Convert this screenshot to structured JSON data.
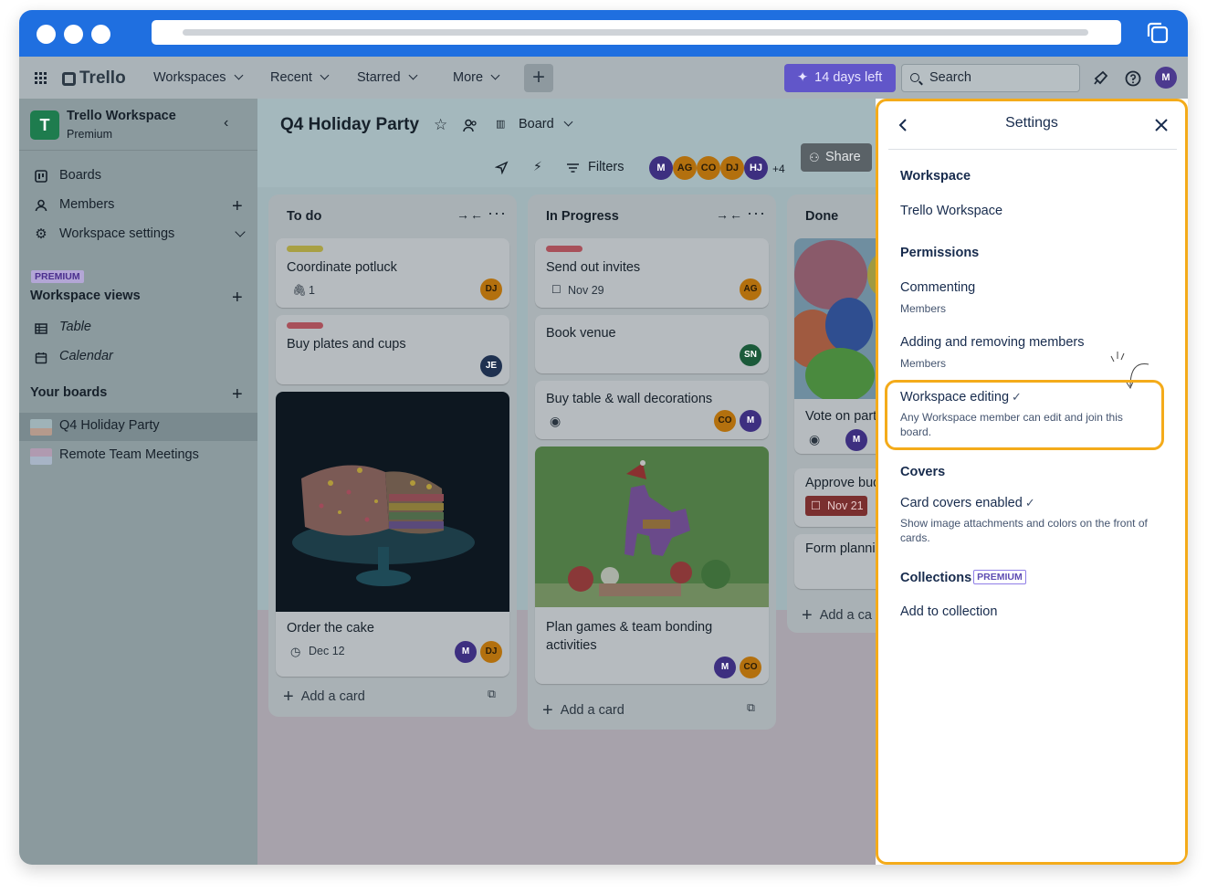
{
  "topnav": {
    "app_name": "Trello",
    "workspaces": "Workspaces",
    "recent": "Recent",
    "starred": "Starred",
    "more": "More",
    "create": "+",
    "trial": "14 days left",
    "search_placeholder": "Search",
    "user_initial": "M"
  },
  "sidebar": {
    "workspace_initial": "T",
    "workspace_name": "Trello Workspace",
    "workspace_plan": "Premium",
    "items": [
      {
        "label": "Boards"
      },
      {
        "label": "Members"
      },
      {
        "label": "Workspace settings"
      }
    ],
    "premium_tag": "PREMIUM",
    "views_heading": "Workspace views",
    "views": [
      {
        "label": "Table"
      },
      {
        "label": "Calendar"
      }
    ],
    "boards_heading": "Your boards",
    "boards": [
      {
        "label": "Q4 Holiday Party"
      },
      {
        "label": "Remote Team Meetings"
      }
    ]
  },
  "board": {
    "title": "Q4 Holiday Party",
    "view": "Board",
    "filters": "Filters",
    "extra_members": "+4",
    "share": "Share",
    "members": [
      "M",
      "AG",
      "CO",
      "DJ",
      "HJ"
    ],
    "lists": [
      {
        "title": "To do",
        "cards": [
          {
            "title": "Coordinate potluck",
            "attachments": "1",
            "member": "DJ"
          },
          {
            "title": "Buy plates and cups",
            "member": "JE"
          },
          {
            "title": "Order the cake",
            "date": "Dec 12",
            "members": [
              "M",
              "DJ"
            ]
          }
        ],
        "add_card": "Add a card"
      },
      {
        "title": "In Progress",
        "cards": [
          {
            "title": "Send out invites",
            "date": "Nov 29",
            "member": "AG"
          },
          {
            "title": "Book venue",
            "member": "SN"
          },
          {
            "title": "Buy table & wall decorations",
            "members": [
              "CO",
              "M"
            ]
          },
          {
            "title": "Plan games & team bonding activities",
            "members": [
              "M",
              "CO"
            ]
          }
        ],
        "add_card": "Add a card"
      },
      {
        "title": "Done",
        "cards": [
          {
            "title": "Vote on part"
          },
          {
            "title": "Approve bud",
            "date": "Nov 21"
          },
          {
            "title": "Form plannii"
          }
        ],
        "add_card": "Add a ca"
      }
    ]
  },
  "settings": {
    "title": "Settings",
    "workspace_heading": "Workspace",
    "workspace_value": "Trello Workspace",
    "permissions_heading": "Permissions",
    "commenting_label": "Commenting",
    "commenting_value": "Members",
    "adding_label": "Adding and removing members",
    "adding_value": "Members",
    "editing_label": "Workspace editing",
    "editing_desc": "Any Workspace member can edit and join this board.",
    "covers_heading": "Covers",
    "covers_label": "Card covers enabled",
    "covers_desc": "Show image attachments and colors on the front of cards.",
    "collections_heading": "Collections",
    "collections_tag": "PREMIUM",
    "collections_item": "Add to collection"
  },
  "colors": {
    "browser_chrome": "#1f6fe0",
    "highlight": "#f4ab1a",
    "trial_purple": "#6156c9",
    "label_yellow": "#d8c44a",
    "label_red": "#d9525c"
  }
}
